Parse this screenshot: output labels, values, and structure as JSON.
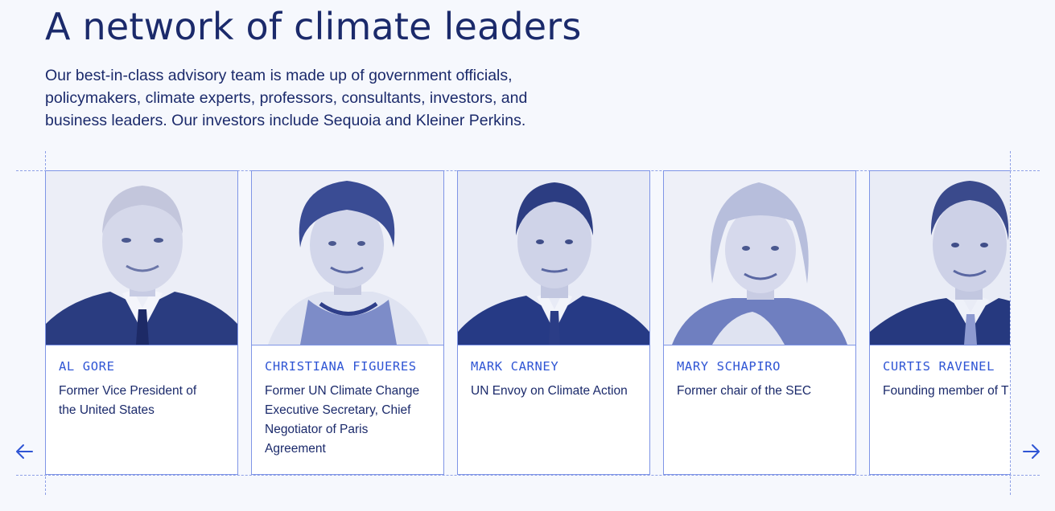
{
  "heading": "A network of climate leaders",
  "intro": "Our best-in-class advisory team is made up of government officials, policymakers, climate experts, professors, consultants, investors, and business leaders. Our investors include Sequoia and Kleiner Perkins.",
  "colors": {
    "background": "#f6f8fd",
    "heading": "#1b2a6b",
    "accent": "#2f55d4",
    "card_border": "#7f95e6"
  },
  "leaders": [
    {
      "name": "AL GORE",
      "role": "Former Vice President of the United States",
      "photo": "portrait-al-gore"
    },
    {
      "name": "CHRISTIANA FIGUERES",
      "role": "Former UN Climate Change Executive Secretary, Chief Negotiator of Paris Agreement",
      "photo": "portrait-christiana-figueres"
    },
    {
      "name": "MARK CARNEY",
      "role": "UN Envoy on Climate Action",
      "photo": "portrait-mark-carney"
    },
    {
      "name": "MARY SCHAPIRO",
      "role": "Former chair of the SEC",
      "photo": "portrait-mary-schapiro"
    },
    {
      "name": "CURTIS RAVENEL",
      "role": "Founding member of T",
      "photo": "portrait-curtis-ravenel"
    }
  ],
  "controls": {
    "prev_icon": "arrow-left-icon",
    "next_icon": "arrow-right-icon"
  }
}
